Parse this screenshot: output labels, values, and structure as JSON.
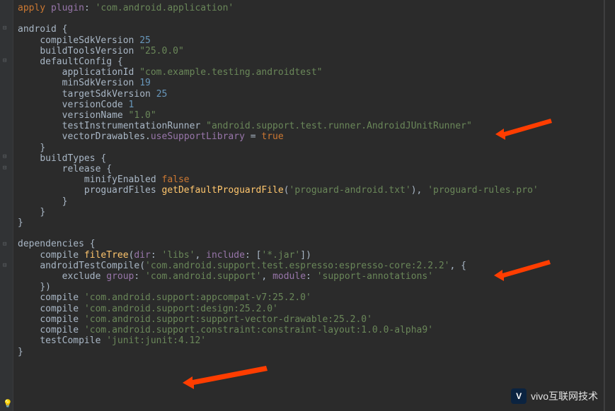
{
  "code": {
    "l1": {
      "kw": "apply",
      "id": "plugin",
      "colon": ":",
      "str": "'com.android.application'"
    },
    "l3": {
      "id": "android",
      "brace": " {"
    },
    "l4": {
      "id": "compileSdkVersion",
      "num": "25"
    },
    "l5": {
      "id": "buildToolsVersion",
      "str": "\"25.0.0\""
    },
    "l6": {
      "id": "defaultConfig",
      "brace": " {"
    },
    "l7": {
      "id": "applicationId",
      "str": "\"com.example.testing.androidtest\""
    },
    "l8": {
      "id": "minSdkVersion",
      "num": "19"
    },
    "l9": {
      "id": "targetSdkVersion",
      "num": "25"
    },
    "l10": {
      "id": "versionCode",
      "num": "1"
    },
    "l11": {
      "id": "versionName",
      "str": "\"1.0\""
    },
    "l12": {
      "id": "testInstrumentationRunner",
      "str": "\"android.support.test.runner.AndroidJUnitRunner\""
    },
    "l13": {
      "a": "vectorDrawables",
      "dot": ".",
      "b": "useSupportLibrary",
      "eq": " = ",
      "kw": "true"
    },
    "l14": {
      "brace": "}"
    },
    "l15": {
      "id": "buildTypes",
      "brace": " {"
    },
    "l16": {
      "id": "release",
      "brace": " {"
    },
    "l17": {
      "id": "minifyEnabled",
      "kw": "false"
    },
    "l18": {
      "a": "proguardFiles",
      "b": "getDefaultProguardFile",
      "p1": "(",
      "str1": "'proguard-android.txt'",
      "p2": ")",
      "comma": ", ",
      "str2": "'proguard-rules.pro'"
    },
    "l19": {
      "brace": "}"
    },
    "l20": {
      "brace": "}"
    },
    "l21": {
      "brace": "}"
    },
    "l23": {
      "id": "dependencies",
      "brace": " {"
    },
    "l24": {
      "a": "compile",
      "b": "fileTree",
      "p1": "(",
      "k1": "dir",
      "c1": ": ",
      "s1": "'libs'",
      "cm": ", ",
      "k2": "include",
      "c2": ": ",
      "br1": "[",
      "s2": "'*.jar'",
      "br2": "]",
      "p2": ")"
    },
    "l25": {
      "a": "androidTestCompile",
      "p1": "(",
      "s1": "'com.android.support.test.espresso:espresso-core:2.2.2'",
      "cm": ", ",
      "br": "{"
    },
    "l26": {
      "a": "exclude",
      "k1": "group",
      "c1": ": ",
      "s1": "'com.android.support'",
      "cm": ", ",
      "k2": "module",
      "c2": ": ",
      "s2": "'support-annotations'"
    },
    "l27": {
      "br": "})"
    },
    "l28": {
      "a": "compile",
      "s": "'com.android.support:appcompat-v7:25.2.0'"
    },
    "l29": {
      "a": "compile",
      "s": "'com.android.support:design:25.2.0'"
    },
    "l30": {
      "a": "compile",
      "s": "'com.android.support:support-vector-drawable:25.2.0'"
    },
    "l31": {
      "a": "compile",
      "s": "'com.android.support.constraint:constraint-layout:1.0.0-alpha9'"
    },
    "l32": {
      "a": "testCompile",
      "s": "'junit:junit:4.12'"
    },
    "l33": {
      "brace": "}"
    }
  },
  "watermark": {
    "icon": "V",
    "text": "vivo互联网技术"
  },
  "arrows": {
    "color": "#ff3d00"
  }
}
